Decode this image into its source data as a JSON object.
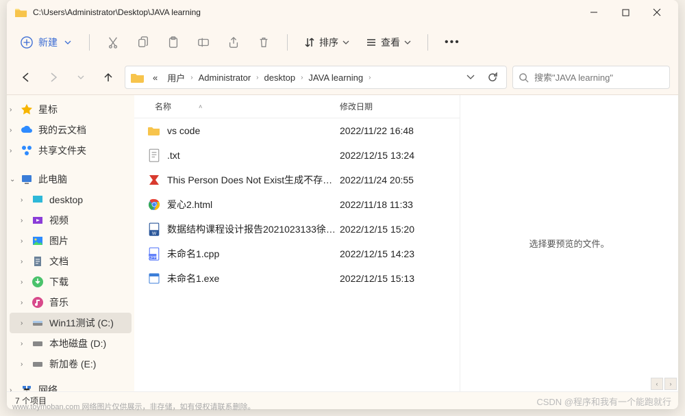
{
  "title_path": "C:\\Users\\Administrator\\Desktop\\JAVA learning",
  "toolbar": {
    "new_label": "新建",
    "sort_label": "排序",
    "view_label": "查看"
  },
  "breadcrumbs": [
    "«",
    "用户",
    "Administrator",
    "desktop",
    "JAVA learning"
  ],
  "search": {
    "placeholder": "搜索\"JAVA learning\""
  },
  "sidebar": {
    "star": "星标",
    "cloud": "我的云文档",
    "share": "共享文件夹",
    "this_pc": "此电脑",
    "desktop": "desktop",
    "video": "视频",
    "pictures": "图片",
    "documents": "文档",
    "downloads": "下载",
    "music": "音乐",
    "win11": "Win11测试 (C:)",
    "local_d": "本地磁盘 (D:)",
    "new_e": "新加卷 (E:)",
    "network": "网络"
  },
  "columns": {
    "name": "名称",
    "date": "修改日期"
  },
  "files": [
    {
      "icon": "folder",
      "name": "vs code",
      "date": "2022/11/22 16:48"
    },
    {
      "icon": "txt",
      "name": ".txt",
      "date": "2022/12/15 13:24"
    },
    {
      "icon": "wps",
      "name": "This Person Does Not Exist生成不存在...",
      "date": "2022/11/24 20:55"
    },
    {
      "icon": "chrome",
      "name": "爱心2.html",
      "date": "2022/11/18 11:33"
    },
    {
      "icon": "docx",
      "name": "数据结构课程设计报告2021023133徐毅...",
      "date": "2022/12/15 15:20"
    },
    {
      "icon": "cpp",
      "name": "未命名1.cpp",
      "date": "2022/12/15 14:23"
    },
    {
      "icon": "exe",
      "name": "未命名1.exe",
      "date": "2022/12/15 15:13"
    }
  ],
  "preview_text": "选择要预览的文件。",
  "status": "7 个项目",
  "watermark": "www.toymoban.com  网络图片仅供展示，非存储，如有侵权请联系删除。",
  "watermark2": "CSDN @程序和我有一个能跑就行"
}
